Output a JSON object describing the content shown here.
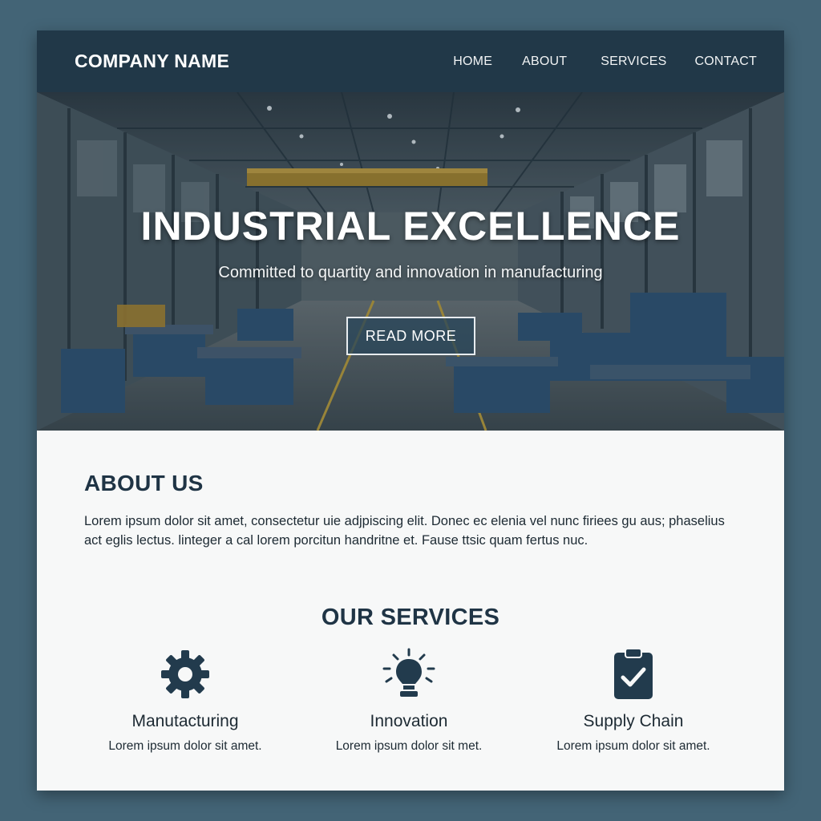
{
  "header": {
    "brand": "COMPANY NAME",
    "nav": [
      "HOME",
      "ABOUT",
      "SERVICES",
      "CONTACT"
    ]
  },
  "hero": {
    "title": "INDUSTRIAL EXCELLENCE",
    "subtitle": "Committed to quartity and innovation in manufacturing",
    "button": "READ MORE"
  },
  "about": {
    "title": "ABOUT US",
    "text": "Lorem ipsum dolor sit amet, consectetur uie adjpiscing elit. Donec ec elenia vel nunc firiees gu aus; phaselius act eglis lectus. linteger a cal lorem porcitun handritne et. Fause ttsic quam fertus nuc."
  },
  "services": {
    "title": "OUR SERVICES",
    "items": [
      {
        "name": "Manutacturing",
        "desc": "Lorem ipsum dolor sit amet.",
        "icon": "gear-icon"
      },
      {
        "name": "Innovation",
        "desc": "Lorem ipsum dolor sit met.",
        "icon": "lightbulb-icon"
      },
      {
        "name": "Supply Chain",
        "desc": "Lorem ipsum dolor sit amet.",
        "icon": "clipboard-check-icon"
      }
    ]
  },
  "colors": {
    "background": "#436476",
    "navbar": "#213848",
    "heading": "#1f3445",
    "icon": "#223b4d"
  }
}
